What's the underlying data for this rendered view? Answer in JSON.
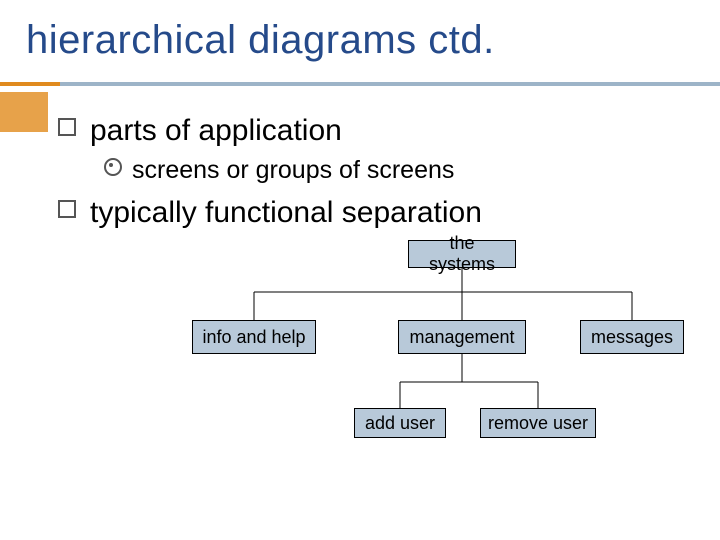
{
  "title": "hierarchical diagrams ctd.",
  "bullets": {
    "b1": "parts of application",
    "b2": "screens or groups of screens",
    "b3": "typically functional separation"
  },
  "nodes": {
    "root": "the systems",
    "c1": "info and help",
    "c2": "management",
    "c3": "messages",
    "g1": "add user",
    "g2": "remove user"
  }
}
